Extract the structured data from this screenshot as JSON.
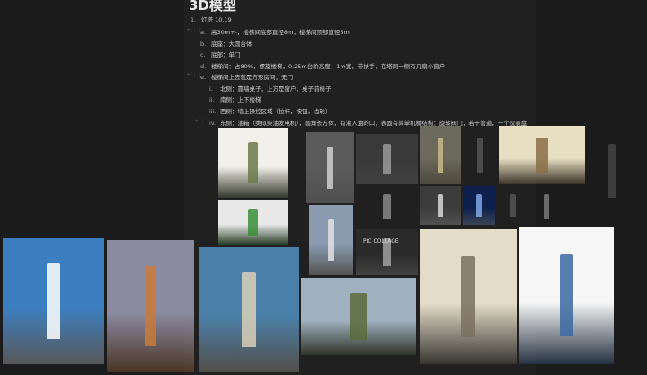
{
  "heading": "3D模型",
  "list": [
    {
      "marker": "1.",
      "text": "灯塔 10.19"
    },
    {
      "marker": "a.",
      "text": "高30m+-，楼梯间底部直径8m，楼梯间顶部直径5m"
    },
    {
      "marker": "b.",
      "text": "底座：大圆台体"
    },
    {
      "marker": "c.",
      "text": "底部：单门"
    },
    {
      "marker": "d.",
      "text": "楼梯间：占80%，螺旋楼梯，0.25m台阶高度，1m宽，带扶手，在塔同一侧有几扇小窗户"
    },
    {
      "marker": "e.",
      "text": "楼梯间上去就是方形房间，无门"
    },
    {
      "marker": "i.",
      "text": "北侧：靠墙桌子，上方是窗户，桌子前椅子"
    },
    {
      "marker": "ii.",
      "text": "南侧：上下楼梯"
    },
    {
      "marker": "iii.",
      "text": "西侧：墙上操控区域（拉杆，按钮，齿轮）"
    },
    {
      "marker": "iv.",
      "text": "东侧：油箱（类似柴油发电机），圆角长方体，有灌入油的口，表面有简单机械结构：旋转阀门，若干管道，一个仪表盘"
    }
  ],
  "images": [
    {
      "name": "generator-image",
      "bg": "#f2f0ea",
      "fg": "#6b7a4a"
    },
    {
      "name": "green-box-image",
      "bg": "#e8e8e8",
      "fg": "#3a8f3a"
    },
    {
      "name": "bw-lighthouse-photo",
      "bg": "#5a5a5a",
      "fg": "#cfcfcf"
    },
    {
      "name": "bw-keepers-photo",
      "bg": "#3a3a3a",
      "fg": "#9a9a9a"
    },
    {
      "name": "lamp-room-photo",
      "bg": "#6b6a5c",
      "fg": "#c9b98a"
    },
    {
      "name": "lens-drawing",
      "bg": "#f0eee8",
      "fg": "#555"
    },
    {
      "name": "sepia-drawings",
      "bg": "#e9dfc3",
      "fg": "#8a6f44"
    },
    {
      "name": "technical-drawing",
      "bg": "#eeeeea",
      "fg": "#444"
    },
    {
      "name": "bw-keepers-photo-2",
      "bg": "#2e2e2e",
      "fg": "#888"
    },
    {
      "name": "fresnel-lens-photo",
      "bg": "#3c3c3c",
      "fg": "#d6d6d6"
    },
    {
      "name": "blueprint-image",
      "bg": "#0d1f4a",
      "fg": "#7fa7e8"
    },
    {
      "name": "lamp-sketch",
      "bg": "#f2f2f2",
      "fg": "#555"
    },
    {
      "name": "lighthouse-sketch",
      "bg": "#f0f0f0",
      "fg": "#777"
    },
    {
      "name": "model-lighthouse-render",
      "bg": "#8a9bb0",
      "fg": "#e0e0e0"
    },
    {
      "name": "pic-collage-photo",
      "bg": "#2a2a2a",
      "fg": "#a0a0a0"
    },
    {
      "name": "harbor-lighthouse-photo",
      "bg": "#3c7fc0",
      "fg": "#ffffff"
    },
    {
      "name": "sunset-lighthouse-photo",
      "bg": "#8a8aa0",
      "fg": "#c97a3a"
    },
    {
      "name": "painted-lighthouse",
      "bg": "#4b7fa8",
      "fg": "#d8cfb8"
    },
    {
      "name": "coastal-lighthouse-photo",
      "bg": "#9fb0bf",
      "fg": "#5b6b3a"
    },
    {
      "name": "elevation-drawing",
      "bg": "#e3dcc8",
      "fg": "#7a7060"
    },
    {
      "name": "cutaway-drawing",
      "bg": "#f6f6f6",
      "fg": "#3a6aa0"
    }
  ],
  "collage_label": "PIC COLLAGE"
}
